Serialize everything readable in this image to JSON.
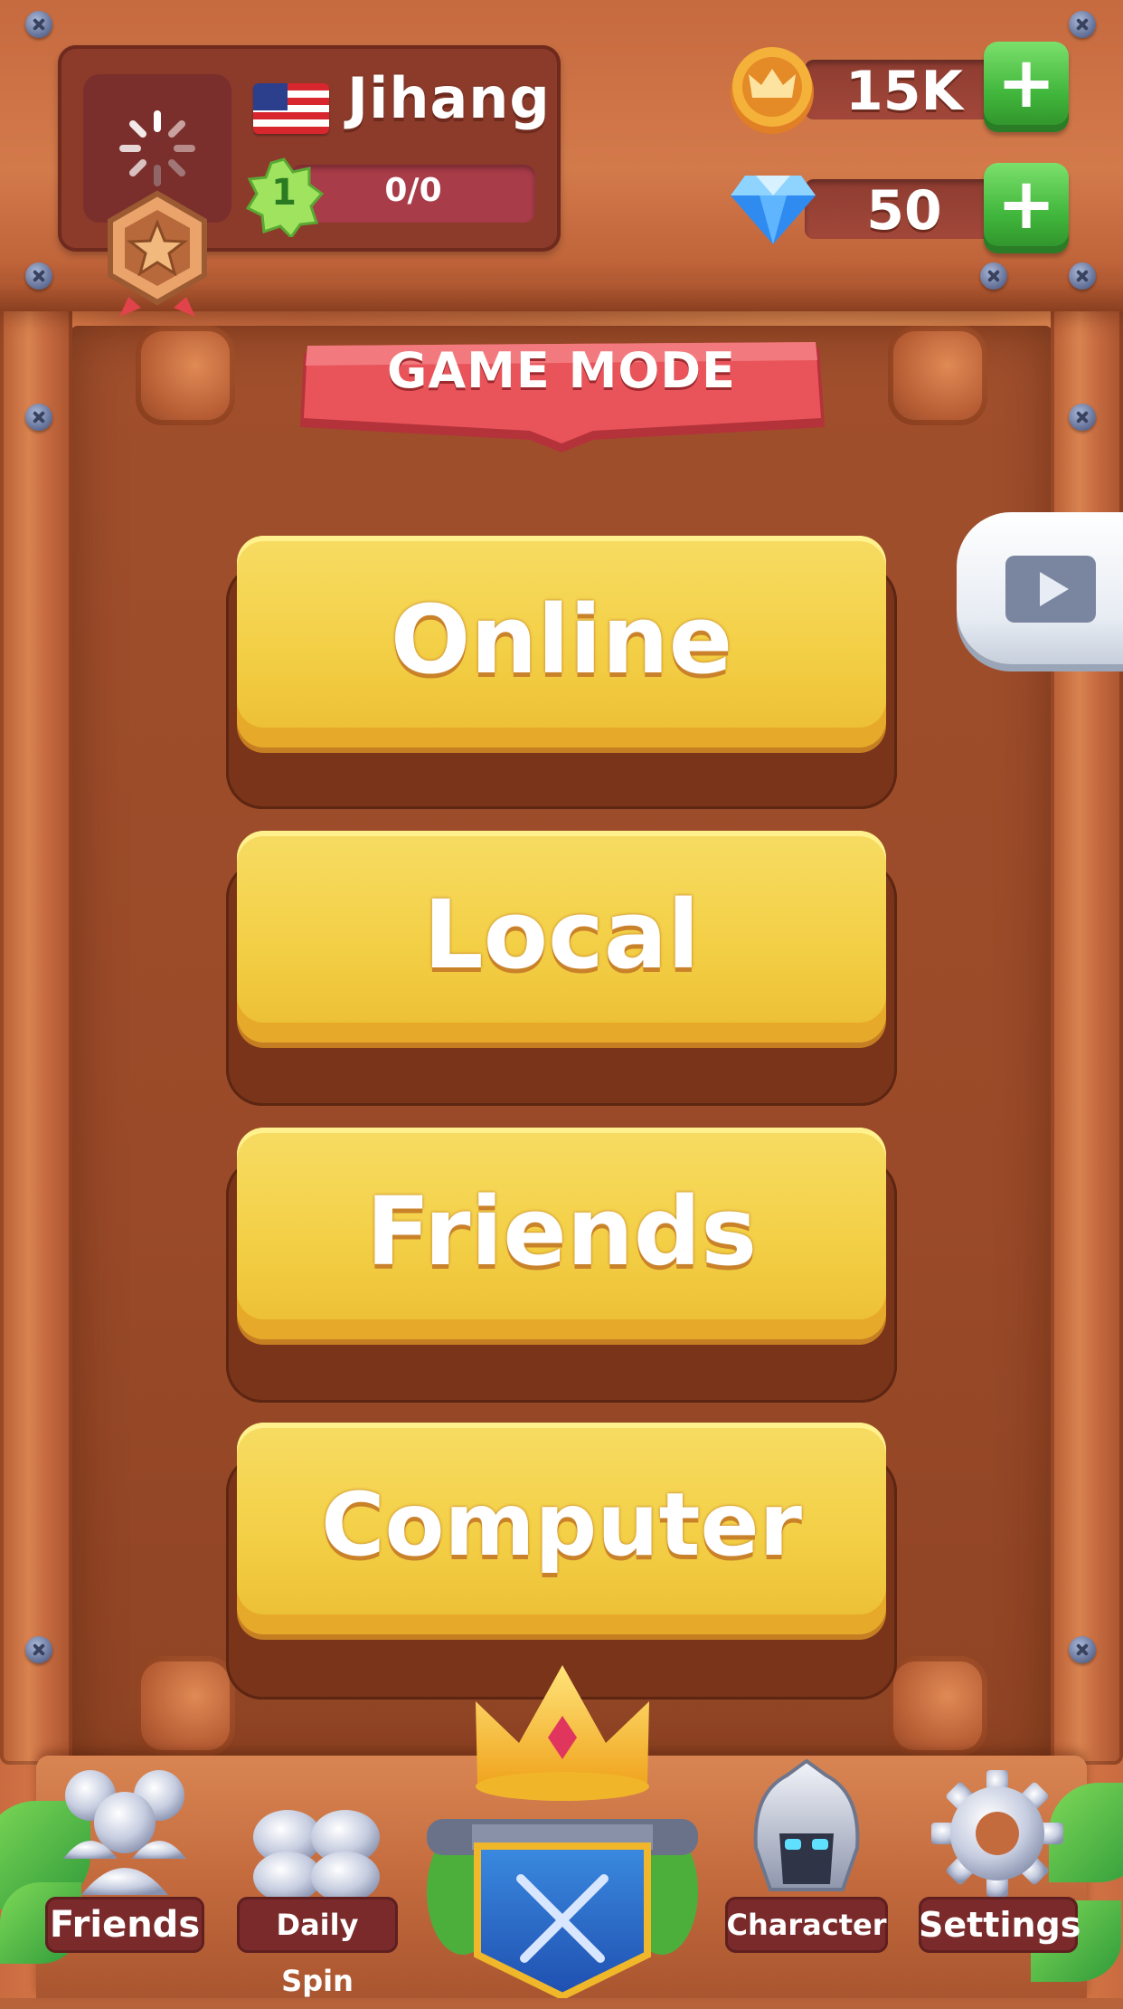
{
  "player": {
    "name": "Jihang",
    "level": "1",
    "xp": "0/0"
  },
  "currency": {
    "coins": "15K",
    "gems": "50"
  },
  "banner": {
    "title": "GAME MODE"
  },
  "modes": [
    {
      "label": "Online"
    },
    {
      "label": "Local"
    },
    {
      "label": "Friends"
    },
    {
      "label": "Computer"
    }
  ],
  "nav": {
    "friends": "Friends",
    "daily_spin": "Daily Spin",
    "character": "Character",
    "settings": "Settings"
  },
  "icons": {
    "coin": "crown-coin-icon",
    "gem": "diamond-icon",
    "plus": "plus-icon",
    "video": "play-video-icon",
    "rank": "star-rank-badge-icon",
    "flag": "us-flag-icon"
  },
  "colors": {
    "button_yellow": "#f3cf45",
    "plus_green": "#3fb43a",
    "banner_red": "#e04a4f",
    "wood": "#b9613a"
  }
}
